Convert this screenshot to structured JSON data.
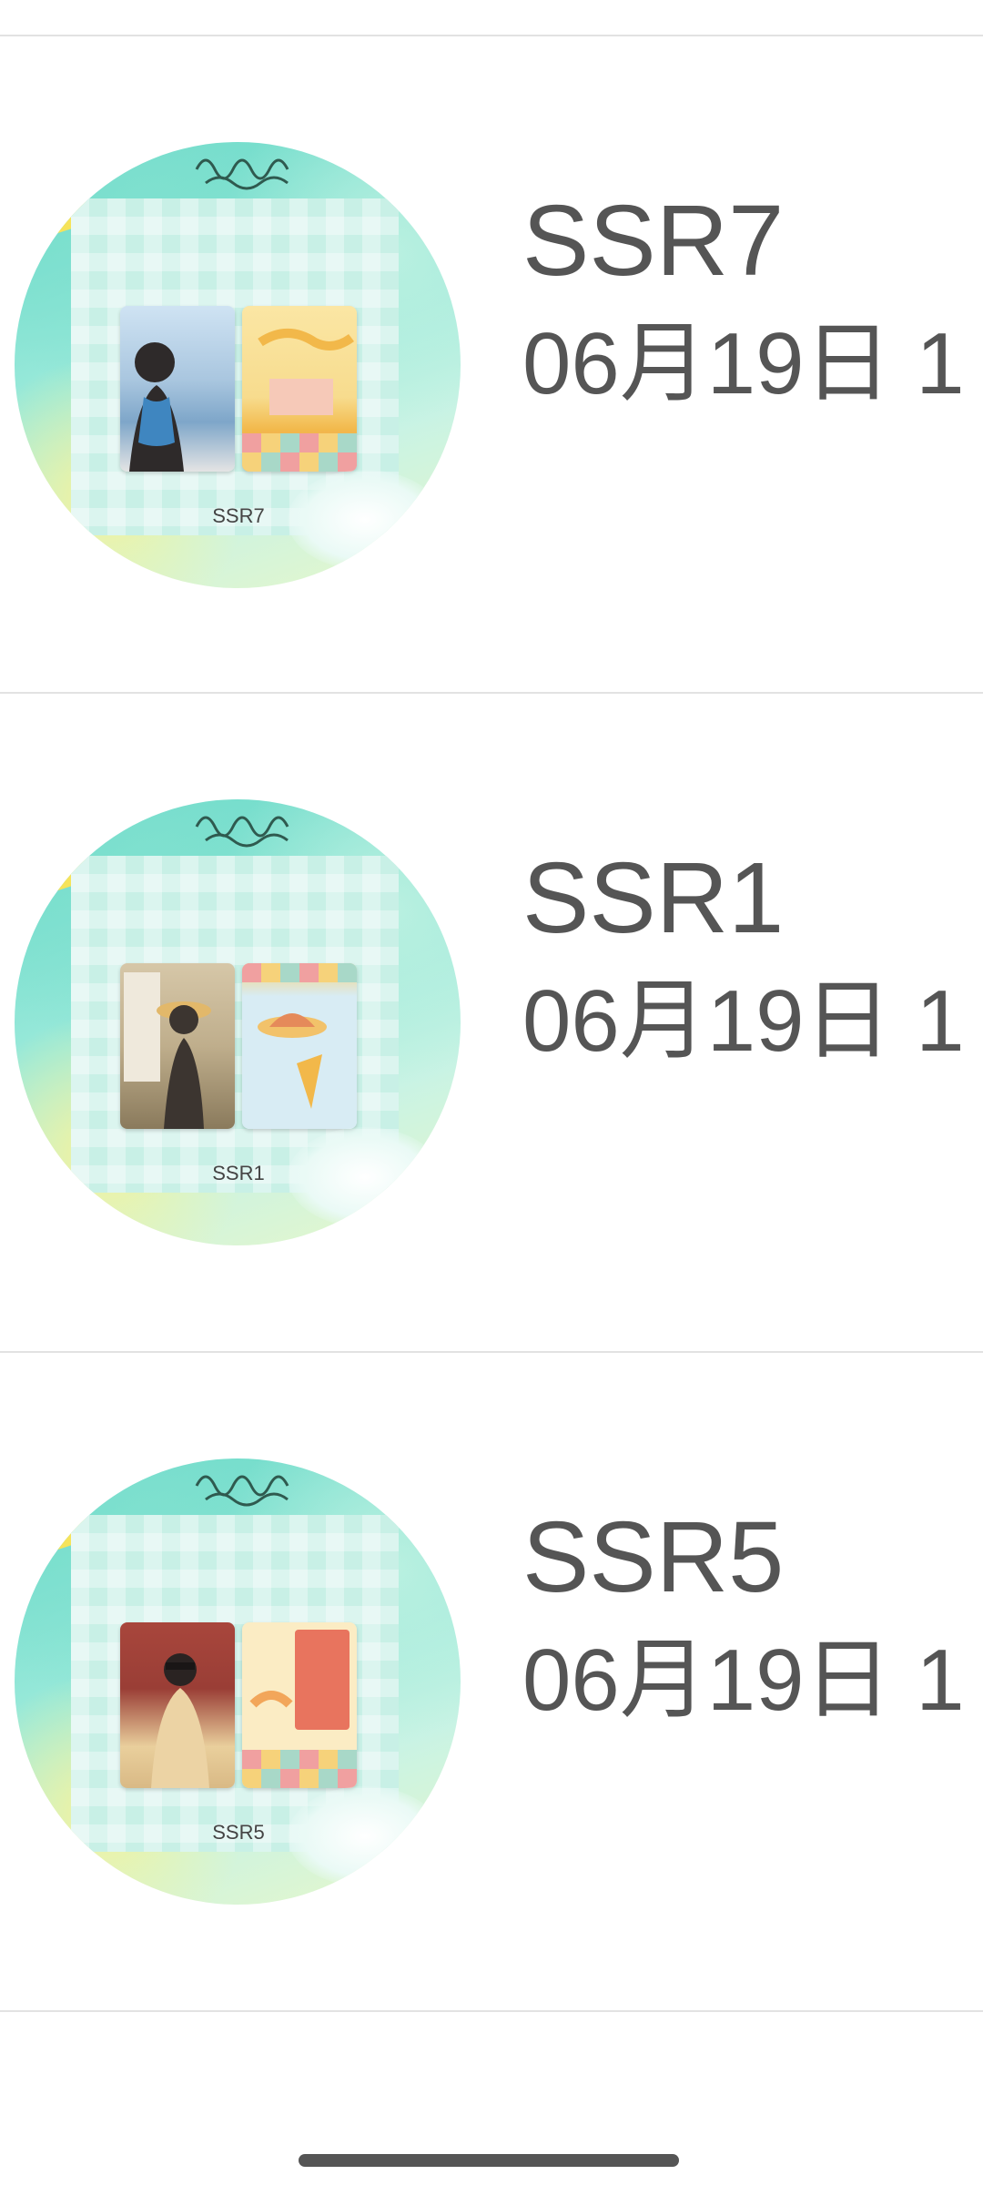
{
  "items": [
    {
      "title": "SSR7",
      "subtitle": "06月19日 1",
      "thumb_caption": "SSR7",
      "photo_colors": [
        "#cfe3f3",
        "#7ea6c9",
        "#2e2a2a"
      ],
      "art_colors": [
        "#fbe6a4",
        "#f2b84a",
        "#f09a8a"
      ]
    },
    {
      "title": "SSR1",
      "subtitle": "06月19日 1",
      "thumb_caption": "SSR1",
      "photo_colors": [
        "#d6c7a8",
        "#8a7a5c",
        "#3c3530"
      ],
      "art_colors": [
        "#d8ecf4",
        "#f2c26a",
        "#e58a5a"
      ]
    },
    {
      "title": "SSR5",
      "subtitle": "06月19日 1",
      "thumb_caption": "SSR5",
      "photo_colors": [
        "#a8463c",
        "#e9cf9c",
        "#2a2322"
      ],
      "art_colors": [
        "#fbecc4",
        "#e8745e",
        "#f2a65a"
      ]
    }
  ],
  "icons": {
    "bunny": "bunny-sticker-icon",
    "tag": "yellow-tag-icon",
    "scribble": "handwriting-scribble-icon"
  }
}
